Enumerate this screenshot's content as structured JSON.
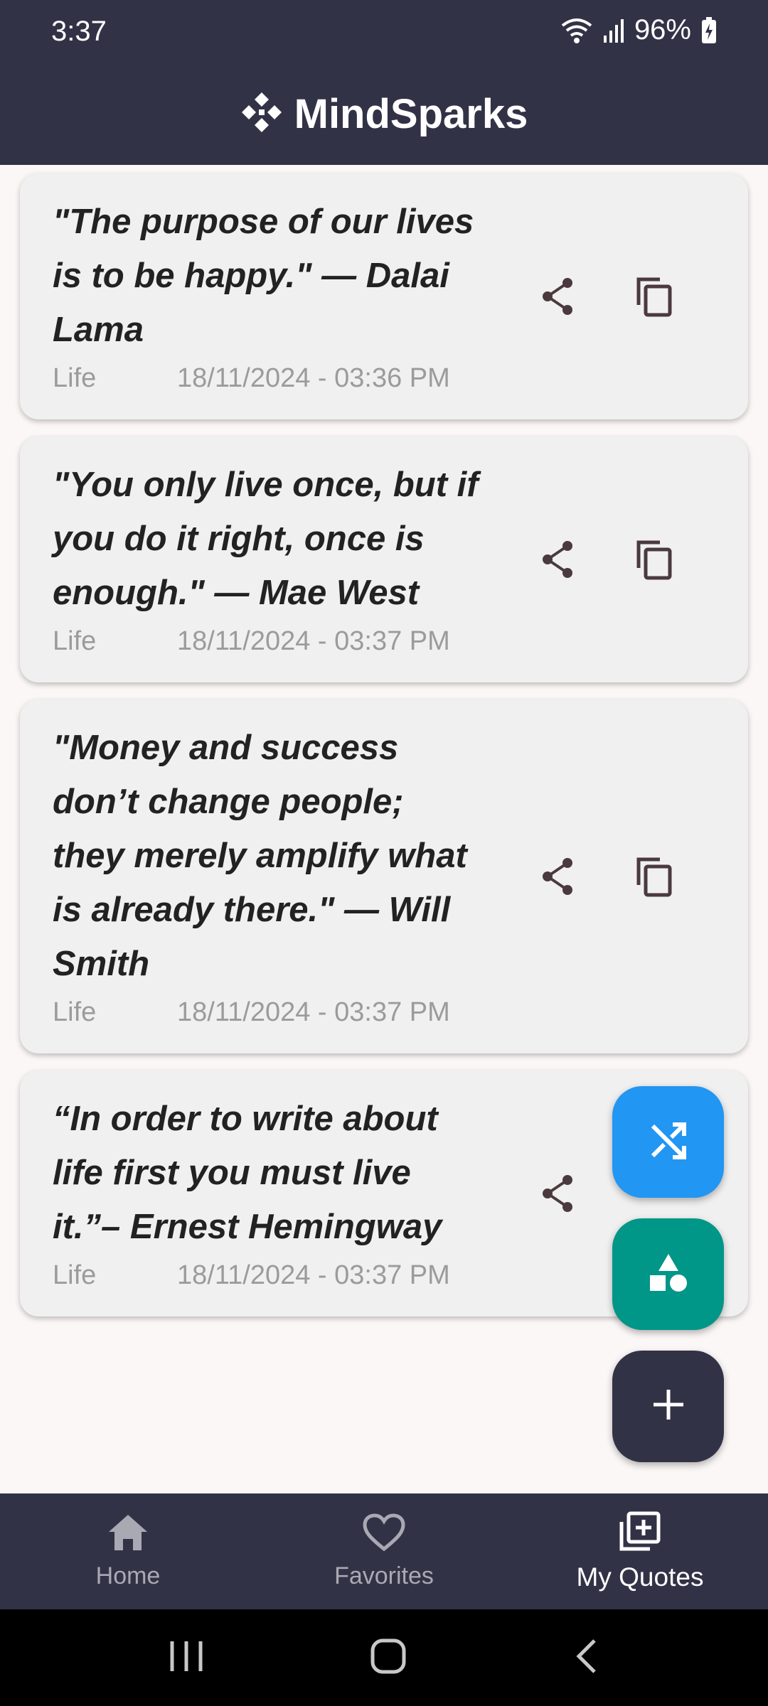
{
  "status_bar": {
    "time": "3:37",
    "battery": "96%"
  },
  "app_bar": {
    "title": "MindSparks",
    "logo_icon": "diamond-move-icon"
  },
  "quotes": [
    {
      "text": "\"The purpose of our lives is to be happy.\" — Dalai Lama",
      "category": "Life",
      "timestamp": "18/11/2024 - 03:36 PM"
    },
    {
      "text": "\"You only live once, but if you do it right, once is enough.\" — Mae West",
      "category": "Life",
      "timestamp": "18/11/2024 - 03:37 PM"
    },
    {
      "text": "\"Money and success don’t change people; they merely amplify what is already there.\" — Will Smith",
      "category": "Life",
      "timestamp": "18/11/2024 - 03:37 PM"
    },
    {
      "text": "“In order to write about life first you must live it.”– Ernest Hemingway",
      "category": "Life",
      "timestamp": "18/11/2024 - 03:37 PM"
    }
  ],
  "fabs": {
    "shuffle_icon": "shuffle-icon",
    "category_icon": "shapes-icon",
    "add_icon": "plus-icon",
    "shuffle_color": "#2196f3",
    "category_color": "#009688",
    "add_color": "#323247"
  },
  "bottom_nav": {
    "items": [
      {
        "label": "Home",
        "icon": "home-icon"
      },
      {
        "label": "Favorites",
        "icon": "heart-icon"
      },
      {
        "label": "My Quotes",
        "icon": "add-box-icon"
      }
    ],
    "active": "My Quotes"
  },
  "colors": {
    "primary_dark": "#323247",
    "background": "#fcf7f7",
    "card": "#f0f0f0"
  }
}
